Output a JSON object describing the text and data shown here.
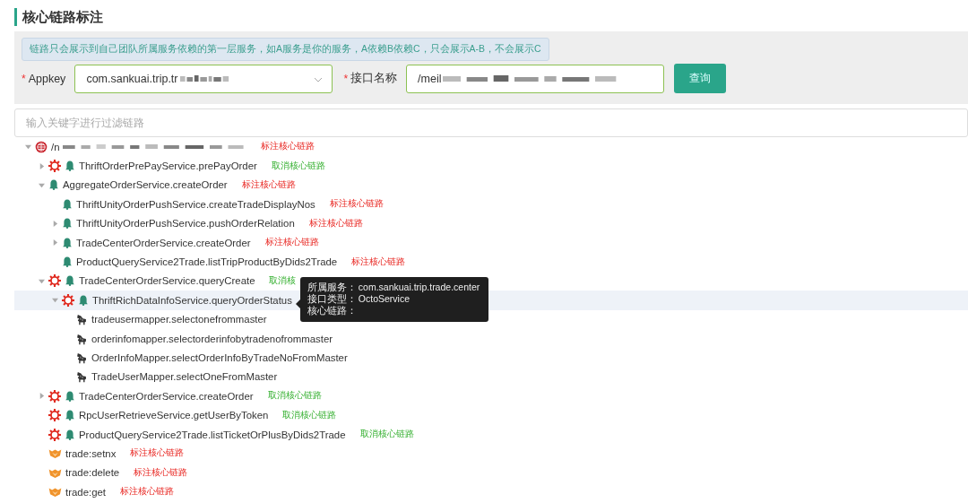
{
  "page": {
    "title": "核心链路标注"
  },
  "form": {
    "notice": "链路只会展示到自己团队所属服务依赖的第一层服务，如A服务是你的服务，A依赖B依赖C，只会展示A-B，不会展示C",
    "fields": [
      {
        "kind": "select",
        "required_mark": "*",
        "label": "Appkey",
        "value": "com.sankuai.trip.tr"
      },
      {
        "kind": "input",
        "required_mark": "*",
        "label": "接口名称",
        "value": "/meil"
      }
    ],
    "button": "查询"
  },
  "filter": {
    "placeholder": "输入关键字进行过滤链路"
  },
  "tree": [
    {
      "kind": "root",
      "label": "/n",
      "core": false,
      "selected": false,
      "expanded": true,
      "action": "标注核心链路",
      "children": [
        {
          "kind": "service",
          "label": "ThriftOrderPrePayService.prePayOrder",
          "core": true,
          "selected": false,
          "expanded": false,
          "action": "取消核心链路"
        },
        {
          "kind": "service",
          "label": "AggregateOrderService.createOrder",
          "core": false,
          "selected": false,
          "expanded": true,
          "action": "标注核心链路",
          "children": [
            {
              "kind": "service",
              "label": "ThriftUnityOrderPushService.createTradeDisplayNos",
              "core": false,
              "selected": false,
              "action": "标注核心链路"
            },
            {
              "kind": "service",
              "label": "ThriftUnityOrderPushService.pushOrderRelation",
              "core": false,
              "selected": false,
              "expanded": false,
              "action": "标注核心链路"
            },
            {
              "kind": "service",
              "label": "TradeCenterOrderService.createOrder",
              "core": false,
              "selected": false,
              "expanded": false,
              "action": "标注核心链路"
            },
            {
              "kind": "service",
              "label": "ProductQueryService2Trade.listTripProductByDids2Trade",
              "core": false,
              "selected": false,
              "action": "标注核心链路"
            }
          ]
        },
        {
          "kind": "service",
          "label": "TradeCenterOrderService.queryCreate",
          "core": true,
          "selected": false,
          "expanded": true,
          "action": "取消核",
          "children": [
            {
              "kind": "service",
              "label": "ThriftRichDataInfoService.queryOrderStatus",
              "core": true,
              "selected": true,
              "expanded": true,
              "tooltip": [
                {
                  "key": "所属服务：",
                  "value": "com.sankuai.trip.trade.center"
                },
                {
                  "key": "接口类型：",
                  "value": "OctoService"
                },
                {
                  "key": "核心链路："
                }
              ],
              "children": [
                {
                  "kind": "db",
                  "label": "tradeusermapper.selectonefrommaster",
                  "core": false,
                  "selected": false
                },
                {
                  "kind": "db",
                  "label": "orderinfomapper.selectorderinfobytradenofrommaster",
                  "core": false,
                  "selected": false
                },
                {
                  "kind": "db",
                  "label": "OrderInfoMapper.selectOrderInfoByTradeNoFromMaster",
                  "core": false,
                  "selected": false
                },
                {
                  "kind": "db",
                  "label": "TradeUserMapper.selectOneFromMaster",
                  "core": false,
                  "selected": false
                }
              ]
            }
          ]
        },
        {
          "kind": "service",
          "label": "TradeCenterOrderService.createOrder",
          "core": true,
          "selected": false,
          "expanded": false,
          "action": "取消核心链路"
        },
        {
          "kind": "service",
          "label": "RpcUserRetrieveService.getUserByToken",
          "core": true,
          "selected": false,
          "action": "取消核心链路"
        },
        {
          "kind": "service",
          "label": "ProductQueryService2Trade.listTicketOrPlusByDids2Trade",
          "core": true,
          "selected": false,
          "action": "取消核心链路"
        },
        {
          "kind": "cache",
          "label": "trade:setnx",
          "core": false,
          "selected": false,
          "action": "标注核心链路"
        },
        {
          "kind": "cache",
          "label": "trade:delete",
          "core": false,
          "selected": false,
          "action": "标注核心链路"
        },
        {
          "kind": "cache",
          "label": "trade:get",
          "core": false,
          "selected": false,
          "action": "标注核心链路"
        }
      ]
    }
  ]
}
